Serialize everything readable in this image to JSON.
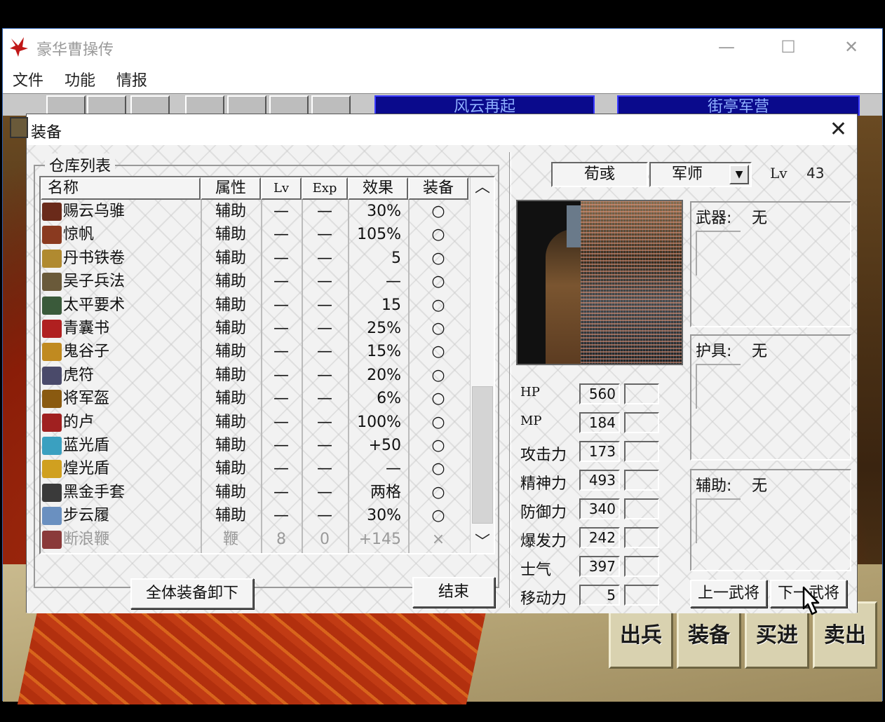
{
  "app": {
    "title": "豪华曹操传",
    "menu": [
      "文件",
      "功能",
      "情报"
    ],
    "toolbar_banners": [
      "风云再起",
      "街亭军营"
    ],
    "actions": [
      "出兵",
      "装备",
      "买进",
      "卖出"
    ]
  },
  "dialog": {
    "title": "装备",
    "group_title": "仓库列表",
    "columns": [
      "名称",
      "属性",
      "Lv",
      "Exp",
      "效果",
      "装备"
    ],
    "items": [
      {
        "name": "赐云乌骓",
        "attr": "辅助",
        "lv": "—",
        "exp": "—",
        "effect": "30%",
        "equip": "○",
        "icon_color": "#6a2a1a"
      },
      {
        "name": "惊帆",
        "attr": "辅助",
        "lv": "—",
        "exp": "—",
        "effect": "105%",
        "equip": "○",
        "icon_color": "#8a3a20"
      },
      {
        "name": "丹书铁卷",
        "attr": "辅助",
        "lv": "—",
        "exp": "—",
        "effect": "5",
        "equip": "○",
        "icon_color": "#b08a30"
      },
      {
        "name": "吴子兵法",
        "attr": "辅助",
        "lv": "—",
        "exp": "—",
        "effect": "—",
        "equip": "○",
        "icon_color": "#6a5a3a"
      },
      {
        "name": "太平要术",
        "attr": "辅助",
        "lv": "—",
        "exp": "—",
        "effect": "15",
        "equip": "○",
        "icon_color": "#3a5a3a"
      },
      {
        "name": "青囊书",
        "attr": "辅助",
        "lv": "—",
        "exp": "—",
        "effect": "25%",
        "equip": "○",
        "icon_color": "#b02020"
      },
      {
        "name": "鬼谷子",
        "attr": "辅助",
        "lv": "—",
        "exp": "—",
        "effect": "15%",
        "equip": "○",
        "icon_color": "#c08a20"
      },
      {
        "name": "虎符",
        "attr": "辅助",
        "lv": "—",
        "exp": "—",
        "effect": "20%",
        "equip": "○",
        "icon_color": "#4a4a6a"
      },
      {
        "name": "将军盔",
        "attr": "辅助",
        "lv": "—",
        "exp": "—",
        "effect": "6%",
        "equip": "○",
        "icon_color": "#8a5a10"
      },
      {
        "name": "的卢",
        "attr": "辅助",
        "lv": "—",
        "exp": "—",
        "effect": "100%",
        "equip": "○",
        "icon_color": "#a02020"
      },
      {
        "name": "蓝光盾",
        "attr": "辅助",
        "lv": "—",
        "exp": "—",
        "effect": "+50",
        "equip": "○",
        "icon_color": "#3aa0c0"
      },
      {
        "name": "煌光盾",
        "attr": "辅助",
        "lv": "—",
        "exp": "—",
        "effect": "—",
        "equip": "○",
        "icon_color": "#d0a020"
      },
      {
        "name": "黑金手套",
        "attr": "辅助",
        "lv": "—",
        "exp": "—",
        "effect": "两格",
        "equip": "○",
        "icon_color": "#3a3a3a"
      },
      {
        "name": "步云履",
        "attr": "辅助",
        "lv": "—",
        "exp": "—",
        "effect": "30%",
        "equip": "○",
        "icon_color": "#6a90c0"
      },
      {
        "name": "断浪鞭",
        "attr": "鞭",
        "lv": "8",
        "exp": "0",
        "effect": "+145",
        "equip": "×",
        "icon_color": "#8a3a3a",
        "disabled": true
      }
    ],
    "buttons": {
      "unequip_all": "全体装备卸下",
      "end": "结束",
      "prev_officer": "上一武将",
      "next_officer": "下一武将"
    },
    "officer": {
      "name": "荀彧",
      "class": "军师",
      "lv_label": "Lv",
      "lv": "43"
    },
    "stats": [
      {
        "label": "HP",
        "value": "560"
      },
      {
        "label": "MP",
        "value": "184"
      },
      {
        "label": "攻击力",
        "value": "173"
      },
      {
        "label": "精神力",
        "value": "493"
      },
      {
        "label": "防御力",
        "value": "340"
      },
      {
        "label": "爆发力",
        "value": "242"
      },
      {
        "label": "士气",
        "value": "397"
      },
      {
        "label": "移动力",
        "value": "5"
      }
    ],
    "slots": [
      {
        "label": "武器:",
        "value": "无"
      },
      {
        "label": "护具:",
        "value": "无"
      },
      {
        "label": "辅助:",
        "value": "无"
      }
    ]
  }
}
